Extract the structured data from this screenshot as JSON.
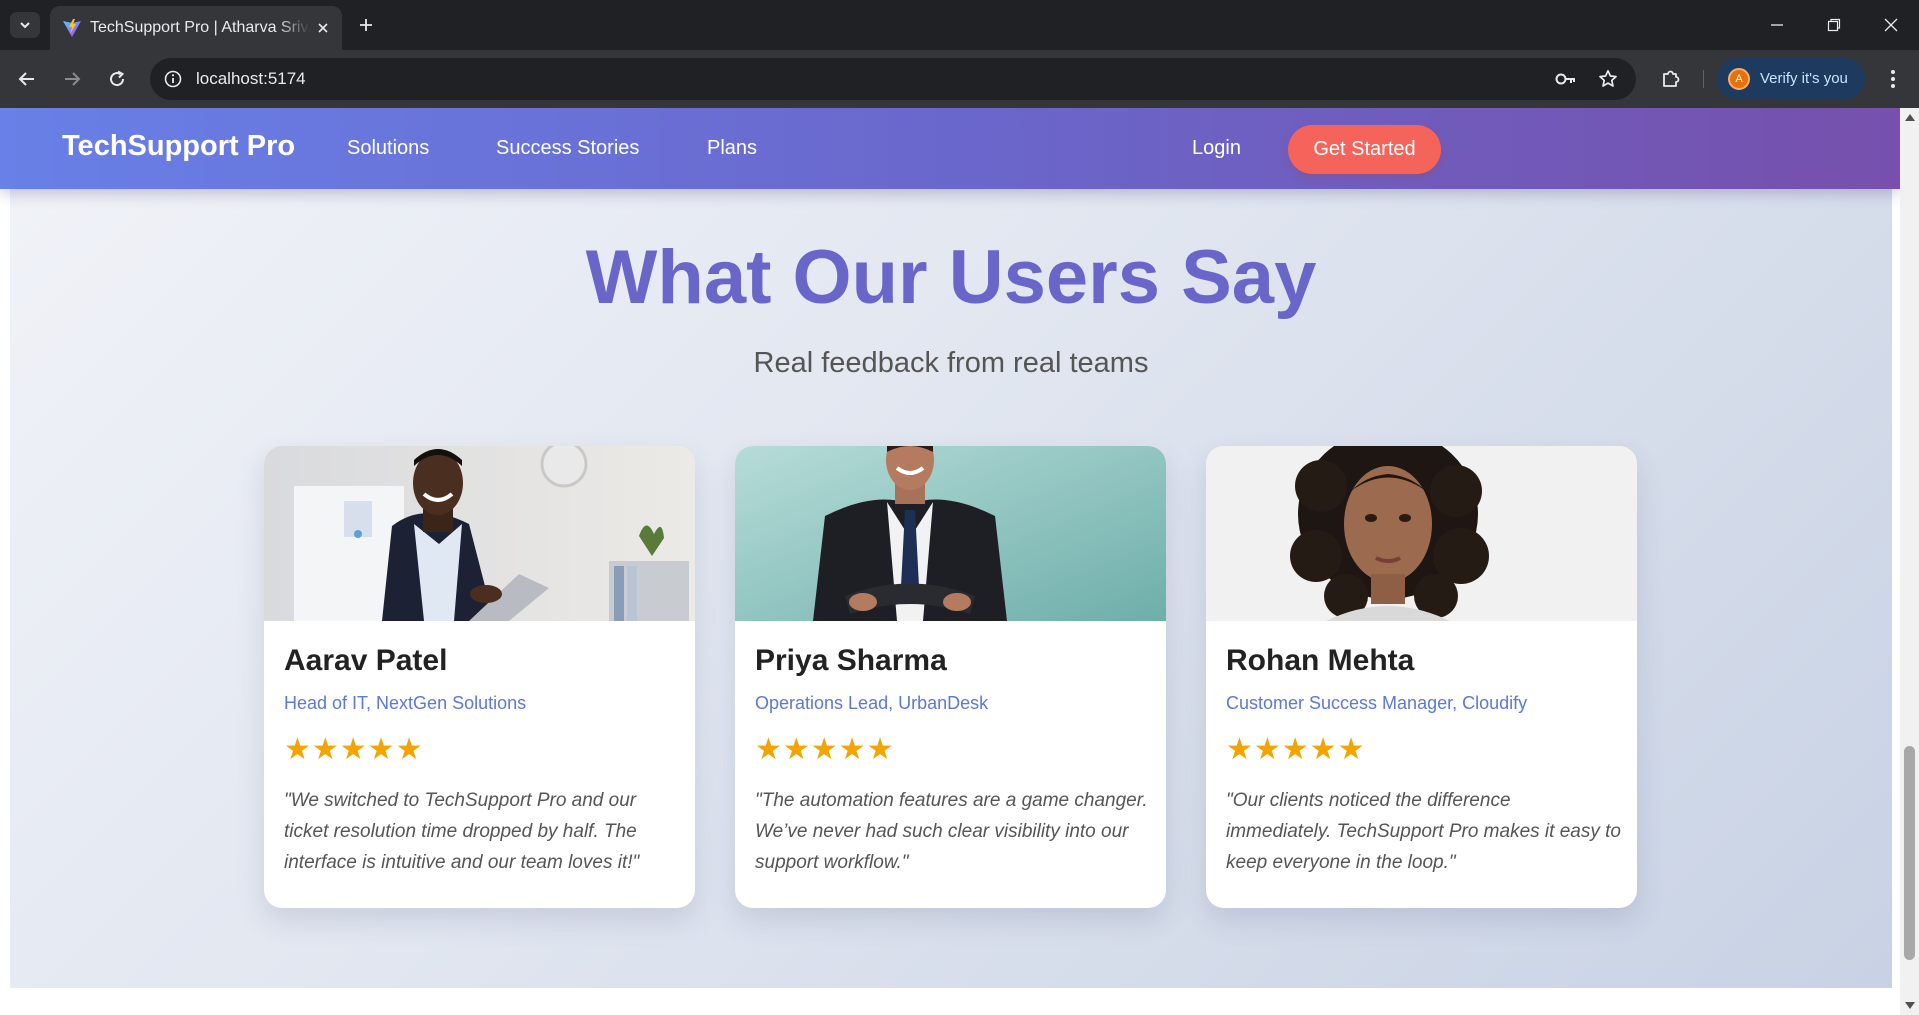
{
  "browser": {
    "tab_title": "TechSupport Pro | Atharva Srivastava",
    "url": "localhost:5174",
    "profile_initial": "A",
    "verify_label": "Verify it's you"
  },
  "nav": {
    "brand": "TechSupport Pro",
    "links": [
      "Solutions",
      "Success Stories",
      "Plans"
    ],
    "login": "Login",
    "cta": "Get Started"
  },
  "section": {
    "title": "What Our Users Say",
    "subtitle": "Real feedback from real teams"
  },
  "testimonials": [
    {
      "name": "Aarav Patel",
      "role": "Head of IT, NextGen Solutions",
      "rating": 5,
      "stars": "★★★★★",
      "quote": "\"We switched to TechSupport Pro and our ticket resolution time dropped by half. The interface is intuitive and our team loves it!\""
    },
    {
      "name": "Priya Sharma",
      "role": "Operations Lead, UrbanDesk",
      "rating": 5,
      "stars": "★★★★★",
      "quote": "\"The automation features are a game changer. We’ve never had such clear visibility into our support workflow.\""
    },
    {
      "name": "Rohan Mehta",
      "role": "Customer Success Manager, Cloudify",
      "rating": 5,
      "stars": "★★★★★",
      "quote": "\"Our clients noticed the difference immediately. TechSupport Pro makes it easy to keep everyone in the loop.\""
    }
  ],
  "colors": {
    "accent": "#6a65c9",
    "cta": "#f5645a",
    "role_text": "#5b79d6",
    "stars": "#f2a400"
  }
}
